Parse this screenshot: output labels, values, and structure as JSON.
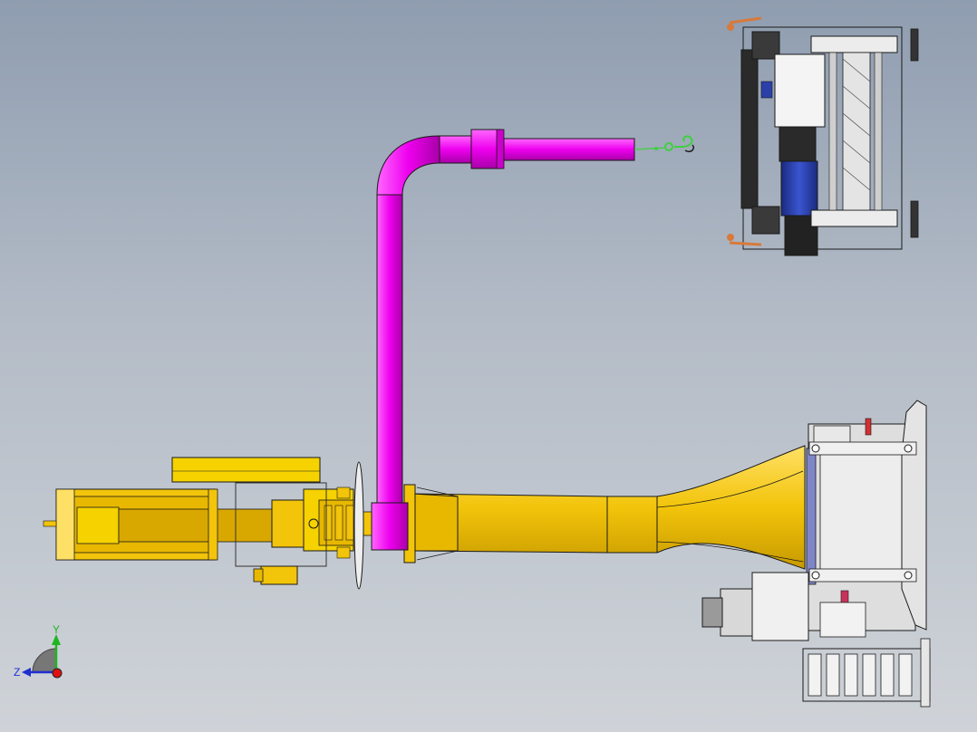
{
  "viewport": {
    "background_top": "#8f9db0",
    "background_bottom": "#cfd3d8"
  },
  "colors": {
    "arm_yellow": "#f2c40a",
    "arm_shadow": "#c79a00",
    "pipe_magenta": "#ee00ee",
    "pipe_shadow": "#b000b0",
    "steel_gray": "#d9d9d9",
    "edge_dark": "#1a1a1a",
    "motor_blue": "#2b3fa8",
    "hook_green": "#3dd13d",
    "cable_orange": "#d77a3a"
  },
  "triad": {
    "y_label": "Y",
    "z_label": "Z",
    "y_color": "#1fb51f",
    "z_color": "#1f2fd0",
    "x_color": "#e01010"
  }
}
